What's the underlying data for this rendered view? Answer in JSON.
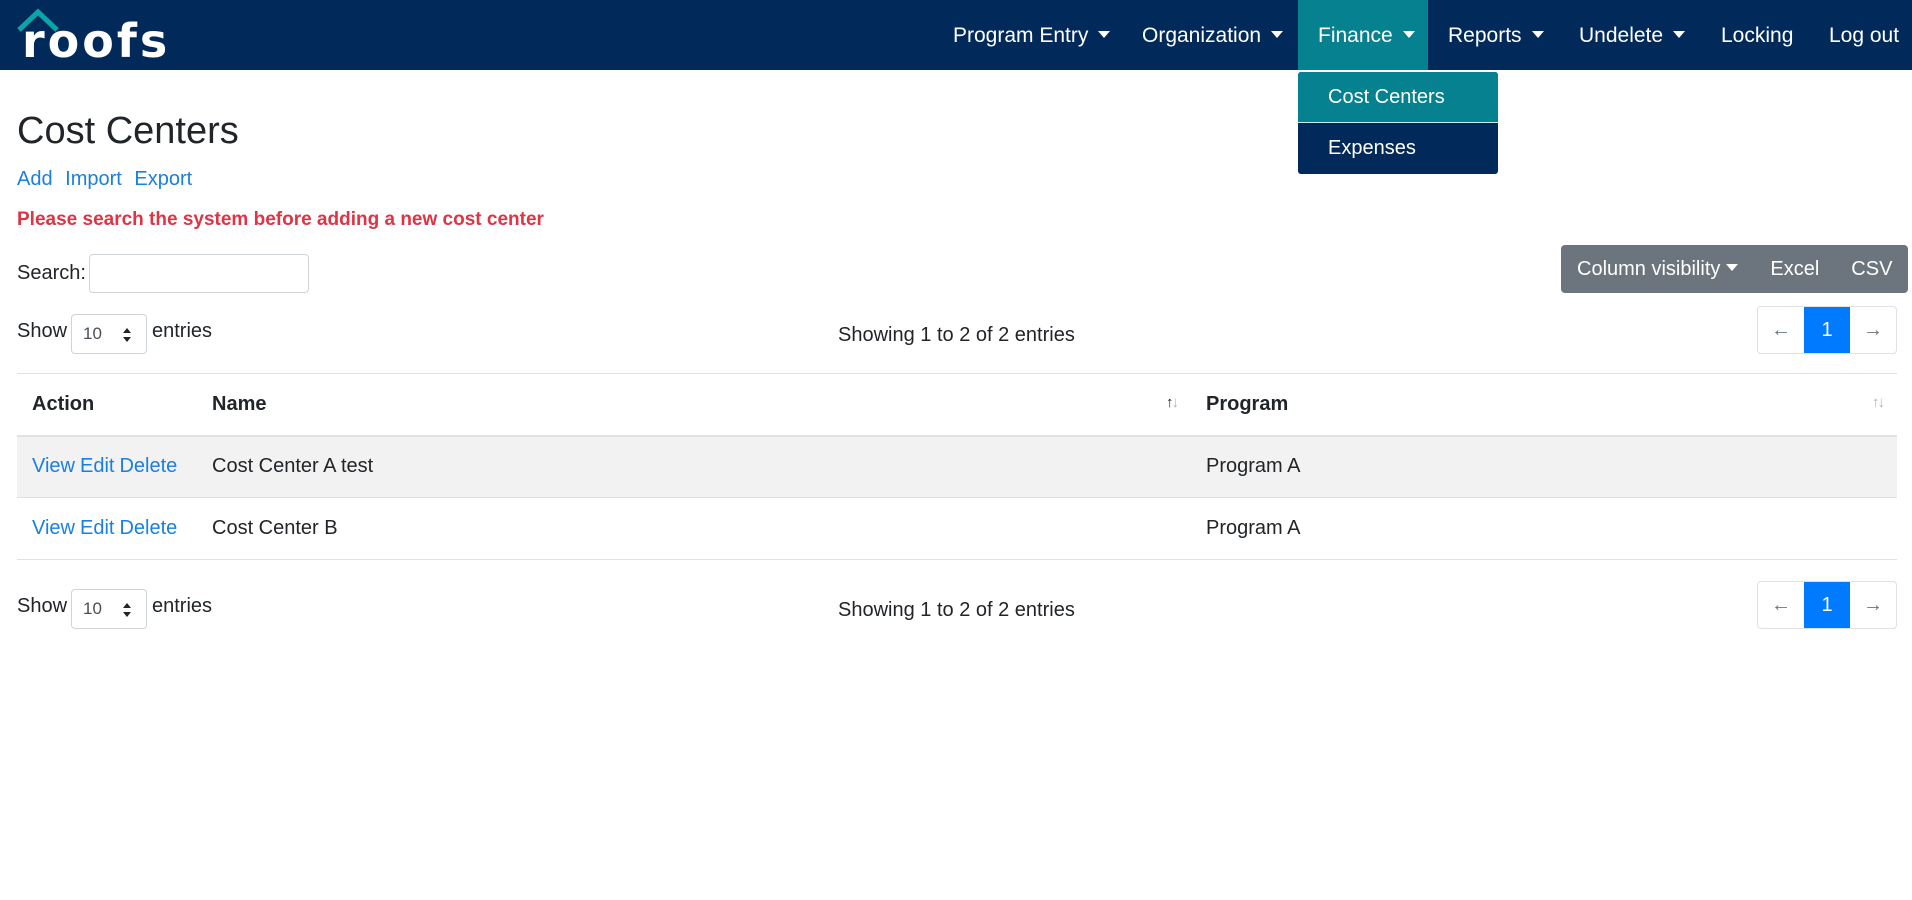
{
  "brand": {
    "logo_text": "roofs",
    "colors": {
      "navbar": "#012a5a",
      "active": "#06818f",
      "link": "#1a7fe0",
      "danger": "#dc3545"
    }
  },
  "nav": {
    "items": [
      {
        "label": "Program Entry"
      },
      {
        "label": "Organization"
      },
      {
        "label": "Finance"
      },
      {
        "label": "Reports"
      },
      {
        "label": "Undelete"
      },
      {
        "label": "Locking"
      },
      {
        "label": "Log out"
      }
    ],
    "finance_menu": [
      "Cost Centers",
      "Expenses"
    ]
  },
  "page": {
    "title": "Cost Centers",
    "actions": [
      "Add",
      "Import",
      "Export"
    ],
    "warning": "Please search the system before adding a new cost center"
  },
  "search": {
    "label": "Search:",
    "value": ""
  },
  "buttons": {
    "column_visibility": "Column visibility",
    "excel": "Excel",
    "csv": "CSV"
  },
  "length": {
    "show": "Show",
    "value": "10",
    "entries": "entries"
  },
  "info": "Showing 1 to 2 of 2 entries",
  "pagination": {
    "prev": "←",
    "current": "1",
    "next": "→"
  },
  "table": {
    "headers": [
      "Action",
      "Name",
      "Program"
    ],
    "row_actions": [
      "View",
      "Edit",
      "Delete"
    ],
    "rows": [
      {
        "name": "Cost Center A test",
        "program": "Program A"
      },
      {
        "name": "Cost Center B",
        "program": "Program A"
      }
    ]
  }
}
